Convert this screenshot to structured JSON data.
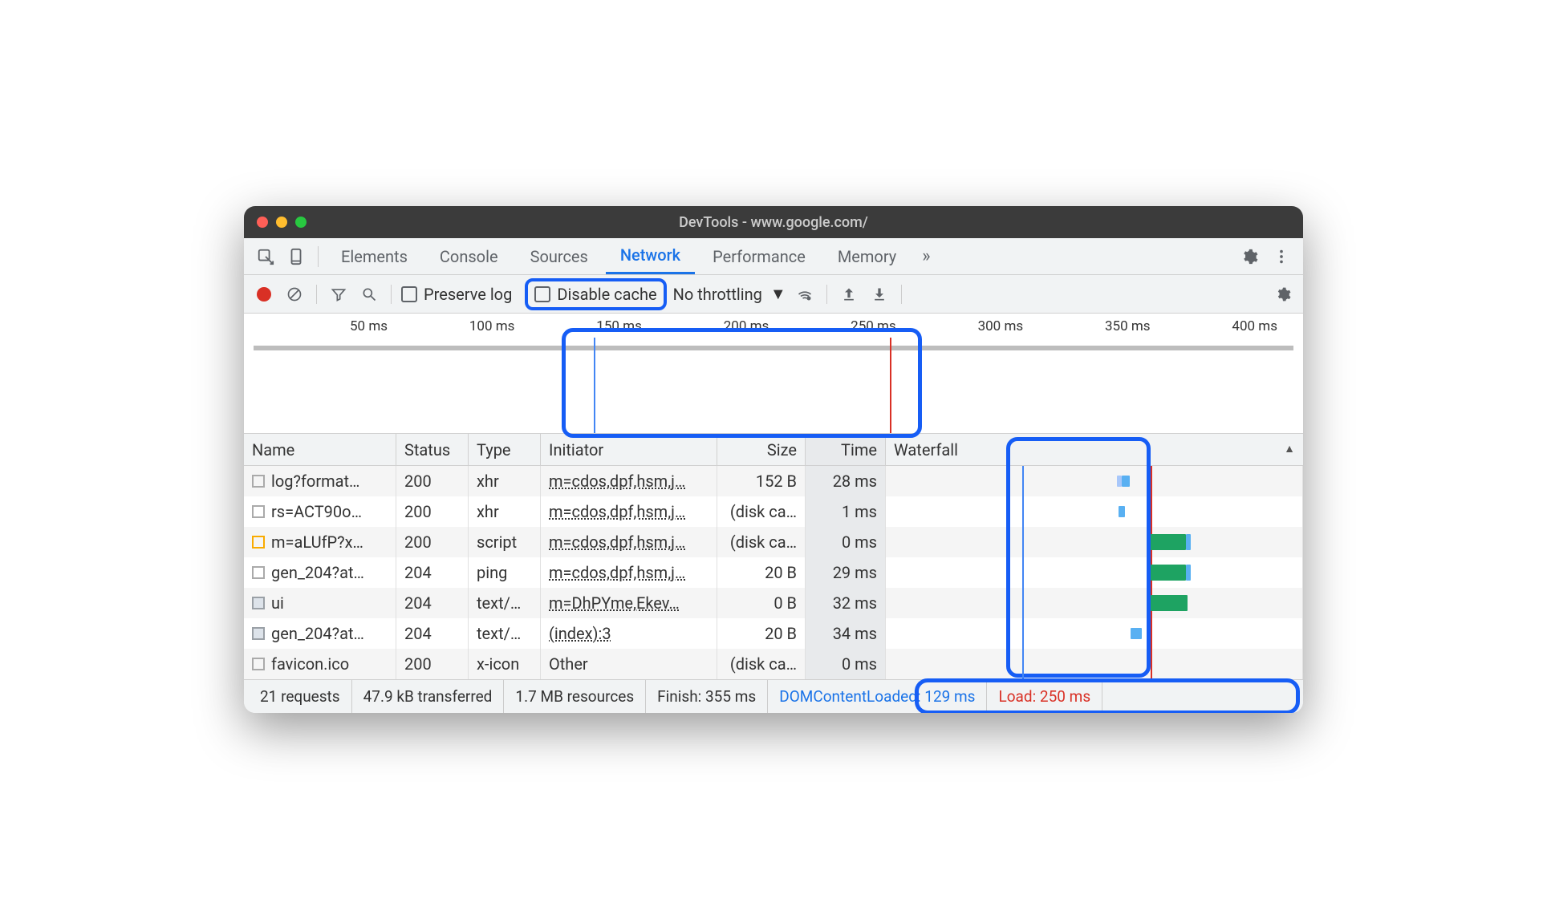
{
  "window_title": "DevTools - www.google.com/",
  "tabs": [
    "Elements",
    "Console",
    "Sources",
    "Network",
    "Performance",
    "Memory"
  ],
  "active_tab": "Network",
  "toolbar": {
    "preserve_log": "Preserve log",
    "disable_cache": "Disable cache",
    "throttling": "No throttling"
  },
  "overview_ticks": [
    "50 ms",
    "100 ms",
    "150 ms",
    "200 ms",
    "250 ms",
    "300 ms",
    "350 ms",
    "400 ms"
  ],
  "columns": {
    "name": "Name",
    "status": "Status",
    "type": "Type",
    "initiator": "Initiator",
    "size": "Size",
    "time": "Time",
    "waterfall": "Waterfall"
  },
  "rows": [
    {
      "name": "log?format…",
      "status": "200",
      "type": "xhr",
      "initiator": "m=cdos,dpf,hsm,j…",
      "size": "152 B",
      "time": "28 ms"
    },
    {
      "name": "rs=ACT90o…",
      "status": "200",
      "type": "xhr",
      "initiator": "m=cdos,dpf,hsm,j…",
      "size": "(disk ca…",
      "time": "1 ms"
    },
    {
      "name": "m=aLUfP?x…",
      "status": "200",
      "type": "script",
      "initiator": "m=cdos,dpf,hsm,j…",
      "size": "(disk ca…",
      "time": "0 ms"
    },
    {
      "name": "gen_204?at…",
      "status": "204",
      "type": "ping",
      "initiator": "m=cdos,dpf,hsm,j…",
      "size": "20 B",
      "time": "29 ms"
    },
    {
      "name": "ui",
      "status": "204",
      "type": "text/…",
      "initiator": "m=DhPYme,Ekev…",
      "size": "0 B",
      "time": "32 ms"
    },
    {
      "name": "gen_204?at…",
      "status": "204",
      "type": "text/…",
      "initiator": "(index):3",
      "size": "20 B",
      "time": "34 ms"
    },
    {
      "name": "favicon.ico",
      "status": "200",
      "type": "x-icon",
      "initiator": "Other",
      "size": "(disk ca…",
      "time": "0 ms"
    }
  ],
  "footer": {
    "requests": "21 requests",
    "transferred": "47.9 kB transferred",
    "resources": "1.7 MB resources",
    "finish": "Finish: 355 ms",
    "dcl": "DOMContentLoaded: 129 ms",
    "load": "Load: 250 ms"
  }
}
